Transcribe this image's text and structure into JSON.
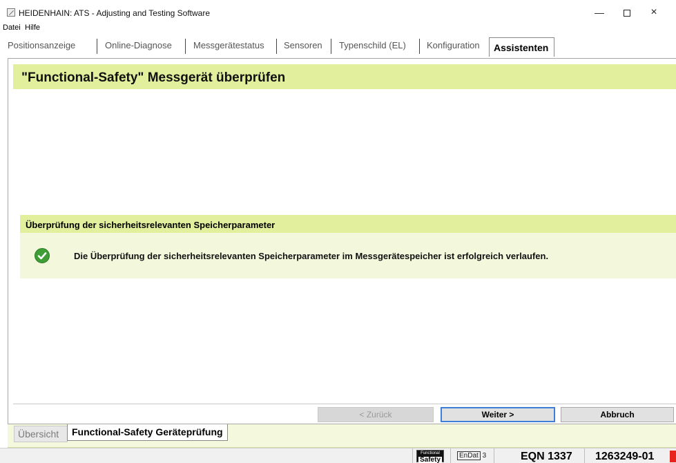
{
  "window": {
    "title": "HEIDENHAIN: ATS - Adjusting and Testing Software",
    "minimize_icon": "minimize-icon",
    "maximize_icon": "maximize-icon",
    "close_glyph": "×"
  },
  "menu": {
    "items": [
      "Datei",
      "Hilfe"
    ]
  },
  "tabs": {
    "items": [
      {
        "label": "Positionsanzeige"
      },
      {
        "label": "Online-Diagnose"
      },
      {
        "label": "Messgerätestatus"
      },
      {
        "label": "Sensoren"
      },
      {
        "label": "Typenschild (EL)"
      },
      {
        "label": "Konfiguration"
      },
      {
        "label": "Assistenten"
      }
    ],
    "active": "Assistenten"
  },
  "main": {
    "title": "\"Functional-Safety\" Messgerät überprüfen",
    "section_title": "Überprüfung der sicherheitsrelevanten Speicherparameter",
    "message": "Die Überprüfung der sicherheitsrelevanten Speicherparameter im Messgerätespeicher ist erfolgreich verlaufen.",
    "message_icon": "success-check-icon"
  },
  "buttons": {
    "back": "< Zurück",
    "next": "Weiter >",
    "abort": "Abbruch"
  },
  "bottom_tabs": {
    "overview": "Übersicht",
    "active": "Functional-Safety Geräteprüfung"
  },
  "status": {
    "fs_badge_top": "Functional",
    "fs_badge_bottom": "Safety",
    "endat_label": "EnDat",
    "endat_version": "3",
    "device": "EQN 1337",
    "id_number": "1263249-01"
  },
  "colors": {
    "accent_band": "#e2ef9c",
    "message_bg": "#f3f8dc",
    "success": "#3e9d35",
    "focus_border": "#3c7fd6",
    "alert": "#e8221d"
  }
}
